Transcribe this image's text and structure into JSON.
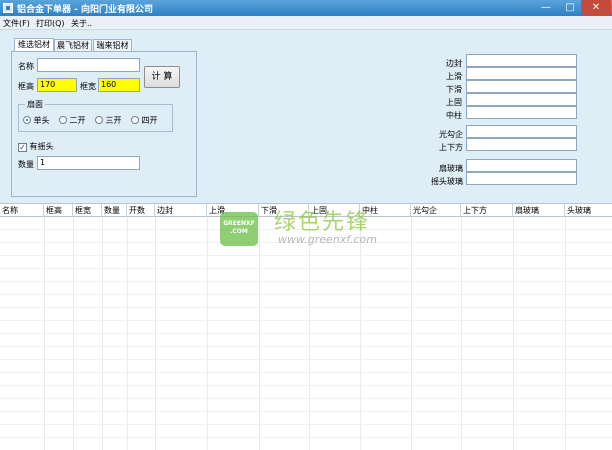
{
  "window": {
    "title": "铝合金下单器 - 向阳门业有限公司",
    "min_glyph": "—",
    "max_glyph": "□",
    "close_glyph": "✕"
  },
  "menu": [
    "文件(F)",
    "打印(Q)",
    "关于.."
  ],
  "tabs": [
    "维选铝材",
    "晨飞铝材",
    "瑞来铝材"
  ],
  "form": {
    "name_label": "名称",
    "name_value": "",
    "frame_height_label": "框高",
    "frame_height_value": "170",
    "frame_width_label": "框宽",
    "frame_width_value": "160",
    "calc_label": "计 算",
    "sash_group_label": "扇面",
    "radios": [
      {
        "label": "单头",
        "checked": true
      },
      {
        "label": "二开",
        "checked": false
      },
      {
        "label": "三开",
        "checked": false
      },
      {
        "label": "四开",
        "checked": false
      }
    ],
    "swing_head_label": "有摇头",
    "swing_head_checked": true,
    "quantity_label": "数量",
    "quantity_value": "1"
  },
  "right_fields": [
    "边封",
    "上滑",
    "下滑",
    "上固",
    "中柱",
    "光勾企",
    "上下方",
    "扇玻璃",
    "摇头玻璃"
  ],
  "table": {
    "columns": [
      "名称",
      "框高",
      "框宽",
      "数量",
      "开数",
      "边封",
      "上滑",
      "下滑",
      "上固",
      "中柱",
      "光勾企",
      "上下方",
      "扇玻璃",
      "头玻璃"
    ]
  },
  "watermark": {
    "logo_text_1": "GREENXF",
    "logo_text_2": ".COM",
    "cn": "绿色先锋",
    "url": "www.greenxf.com"
  },
  "colors": {
    "titlebar": "#2f7fc2",
    "panel": "#dfedf7",
    "highlight_field": "#ffff00",
    "watermark_green": "#8dc63f"
  }
}
